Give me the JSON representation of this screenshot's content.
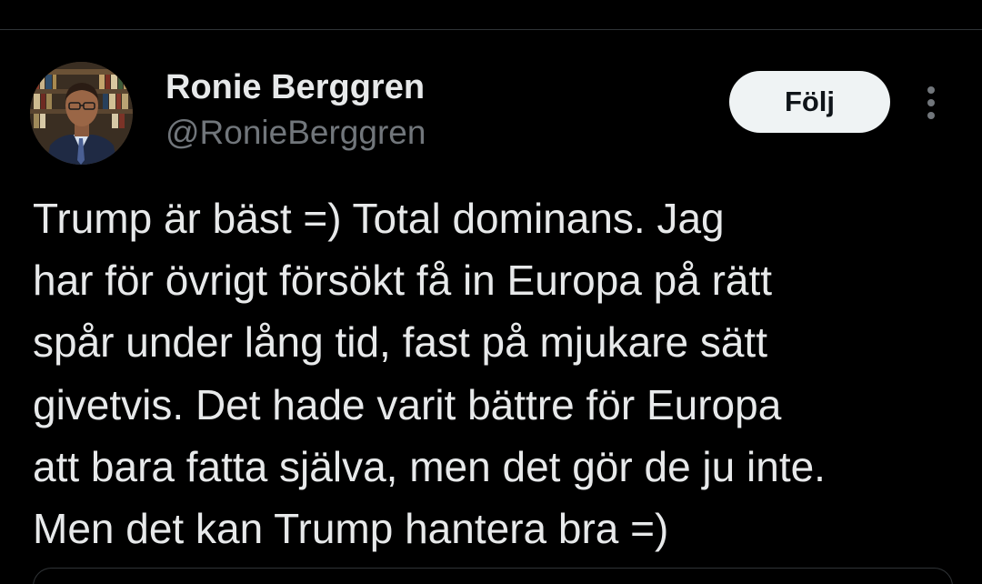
{
  "user": {
    "display_name": "Ronie Berggren",
    "handle": "@RonieBerggren"
  },
  "actions": {
    "follow_label": "Följ",
    "more_icon": "more-vertical-icon"
  },
  "tweet": {
    "text": "Trump är bäst =) Total dominans. Jag\nhar för övrigt försökt få in Europa på rätt\nspår under lång tid, fast på mjukare sätt\ngivetvis. Det hade varit bättre för Europa\natt bara fatta själva, men det gör de ju inte.\nMen det kan Trump hantera bra =)"
  },
  "colors": {
    "background": "#000000",
    "primary_text": "#e7e9ea",
    "secondary_text": "#71767b",
    "follow_button_bg": "#eff3f4",
    "follow_button_text": "#0f1419",
    "divider": "#2f3336"
  }
}
